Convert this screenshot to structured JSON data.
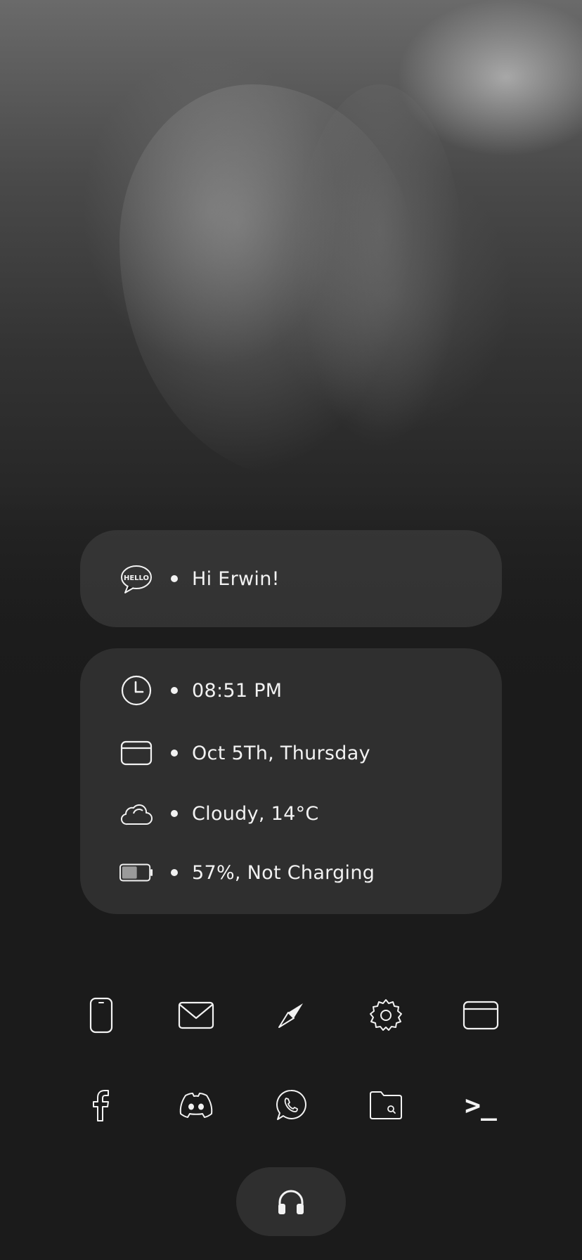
{
  "greeting": {
    "icon": "hello-speech-bubble-icon",
    "icon_text": "HELLO",
    "text": "Hi Erwin!"
  },
  "info": {
    "time": {
      "icon": "clock-icon",
      "text": "08:51 PM"
    },
    "date": {
      "icon": "calendar-card-icon",
      "text": "Oct 5Th, Thursday"
    },
    "weather": {
      "icon": "cloud-icon",
      "text": "Cloudy, 14°C"
    },
    "battery": {
      "icon": "battery-icon",
      "level": 0.57,
      "text": "57%, Not Charging"
    }
  },
  "dock": {
    "row1": [
      "phone-icon",
      "mail-icon",
      "compass-icon",
      "settings-gear-icon",
      "browser-window-icon"
    ],
    "row2": [
      "facebook-icon",
      "discord-icon",
      "whatsapp-icon",
      "files-folder-icon",
      "terminal-icon"
    ],
    "terminal_glyph": ">_"
  },
  "music": {
    "icon": "headphones-icon"
  },
  "colors": {
    "background": "#1b1b1b",
    "card": "#2f2f2f",
    "foreground": "#f2f2f2"
  }
}
